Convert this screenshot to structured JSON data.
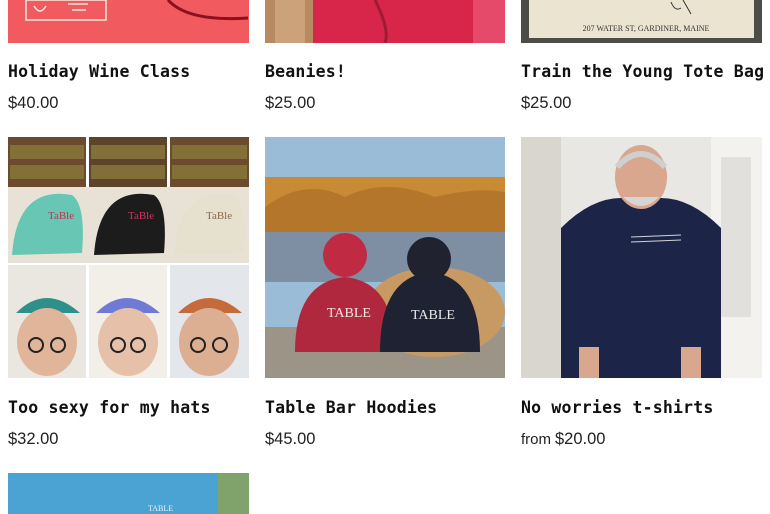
{
  "products": [
    {
      "title": "Holiday Wine Class",
      "price": "$40.00",
      "image_icon": "wine-class-poster"
    },
    {
      "title": "Beanies!",
      "price": "$25.00",
      "image_icon": "red-beanie-photo"
    },
    {
      "title": "Train the Young Tote Bag",
      "price": "$25.00",
      "image_icon": "tote-bag-photo",
      "image_text": "207 WATER ST, GARDINER, MAINE"
    },
    {
      "title": "Too sexy for my hats",
      "price": "$32.00",
      "image_icon": "hats-collage-photo"
    },
    {
      "title": "Table Bar Hoodies",
      "price": "$45.00",
      "image_icon": "hoodies-photo"
    },
    {
      "title": "No worries t-shirts",
      "price_prefix": "from",
      "price": "$20.00",
      "image_icon": "tshirt-photo"
    },
    {
      "title": "",
      "price": "",
      "image_icon": "blue-shirt-photo"
    }
  ],
  "colors": {
    "poster_red": "#f15a5e",
    "beanie_red": "#d8254a",
    "tote_canvas": "#e9e2cf",
    "shirt_blue": "#4aa3d3",
    "navy": "#1c2447"
  }
}
